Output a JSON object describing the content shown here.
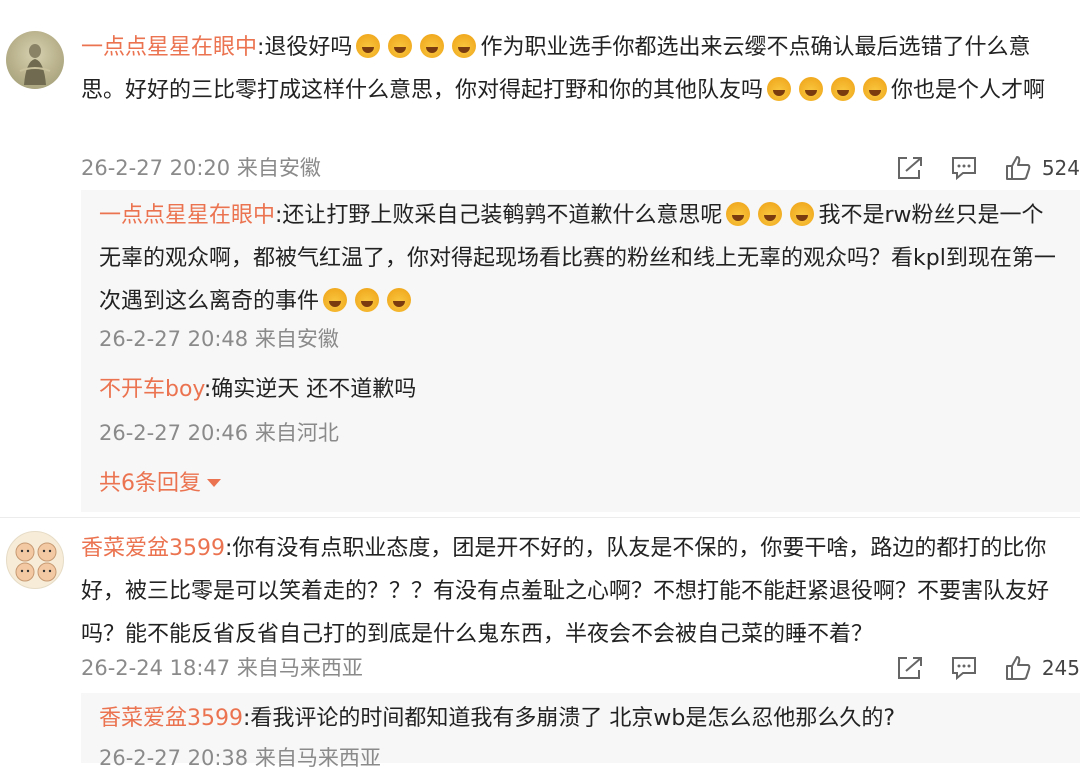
{
  "comments": [
    {
      "user": "一点点星星在眼中",
      "seg1": ":退役好吗",
      "seg2": "作为职业选手你都选出来云缨不点确认最后选错了什么意思。好好的三比零打成这样什么意思，你对得起打野和你的其他队友吗",
      "seg3": "你也是个人才啊",
      "meta": "26-2-27 20:20 来自安徽",
      "likes": "524",
      "replies": [
        {
          "user": "一点点星星在眼中",
          "seg1": ":还让打野上败采自己装鹌鹑不道歉什么意思呢",
          "seg2": "我不是rw粉丝只是一个无辜的观众啊，都被气红温了，你对得起现场看比赛的粉丝和线上无辜的观众吗？看kpl到现在第一次遇到这么离奇的事件",
          "meta": "26-2-27 20:48 来自安徽"
        },
        {
          "user": "不开车boy",
          "seg1": ":确实逆天 还不道歉吗",
          "meta": "26-2-27 20:46 来自河北"
        }
      ],
      "more_label": "共6条回复"
    },
    {
      "user": "香菜爱盆3599",
      "seg1": ":你有没有点职业态度，团是开不好的，队友是不保的，你要干啥，路边的都打的比你好，被三比零是可以笑着走的？？？有没有点羞耻之心啊？不想打能不能赶紧退役啊？不要害队友好吗？能不能反省反省自己打的到底是什么鬼东西，半夜会不会被自己菜的睡不着？",
      "meta": "26-2-24 18:47 来自马来西亚",
      "likes": "245",
      "replies": [
        {
          "user": "香菜爱盆3599",
          "seg1": ":看我评论的时间都知道我有多崩溃了 北京wb是怎么忍他那么久的?",
          "meta": "26-2-27 20:38 来自马来西亚"
        }
      ]
    }
  ],
  "icons": {
    "share": "share-icon",
    "comment": "comment-icon",
    "like": "like-icon",
    "expand": "chevron-down-icon"
  },
  "colors": {
    "username": "#eb7350",
    "meta": "#8a8a8a",
    "reply_bg": "#f7f7f7"
  }
}
